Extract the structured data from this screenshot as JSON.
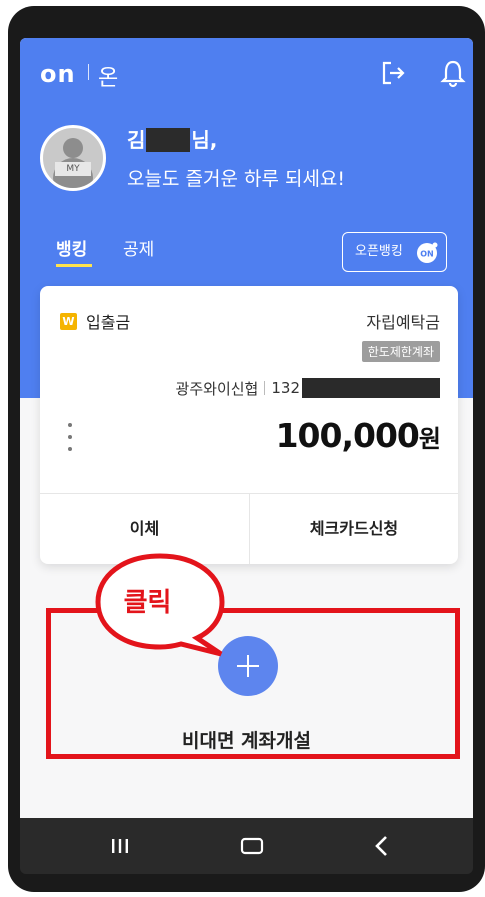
{
  "header": {
    "logo": "on",
    "logo_ko": "온",
    "logout_icon": "logout-icon",
    "bell_icon": "bell-icon"
  },
  "profile": {
    "avatar_tag": "MY",
    "name_first": "김",
    "name_suffix": "님,",
    "greeting": "오늘도 즐거운 하루 되세요!"
  },
  "tabs": {
    "banking": "뱅킹",
    "gongje": "공제",
    "open_banking": "오픈뱅킹",
    "open_banking_badge": "ON"
  },
  "account": {
    "type_badge": "W",
    "type": "입출금",
    "product": "자립예탁금",
    "limit_badge": "한도제한계좌",
    "bank": "광주와이신협",
    "number_prefix": "132",
    "balance": "100,000",
    "balance_unit": "원",
    "transfer": "이체",
    "check_card": "체크카드신청"
  },
  "add_account": {
    "label": "비대면 계좌개설"
  },
  "annotation": {
    "callout": "클릭"
  },
  "colors": {
    "header_blue": "#4f7ff0",
    "plus_blue": "#5d85ee",
    "highlight_red": "#e3141b",
    "tab_underline": "#ffe34d"
  }
}
